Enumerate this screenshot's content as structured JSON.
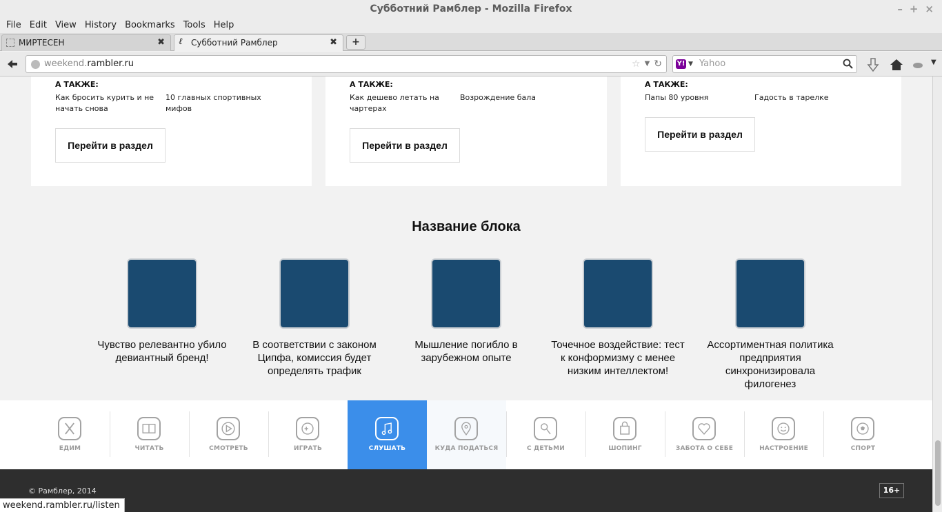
{
  "window": {
    "title": "Субботний Рамблер - Mozilla Firefox",
    "controls": [
      "–",
      "+",
      "×"
    ]
  },
  "menu": [
    "File",
    "Edit",
    "View",
    "History",
    "Bookmarks",
    "Tools",
    "Help"
  ],
  "tabs": [
    {
      "label": "МИРТЕСЕН",
      "active": false
    },
    {
      "label": "Субботний Рамблер",
      "active": true
    }
  ],
  "newtab_label": "+",
  "address": {
    "prefix": "weekend.",
    "domain": "rambler.ru"
  },
  "search": {
    "engine_icon": "Y!",
    "placeholder": "Yahoo"
  },
  "cards": [
    {
      "also": "А ТАКЖЕ:",
      "links": [
        "Как бросить курить и не начать снова",
        "10 главных спортивных мифов"
      ],
      "button": "Перейти в раздел"
    },
    {
      "also": "А ТАКЖЕ:",
      "links": [
        "Как дешево летать на чартерах",
        "Возрождение бала"
      ],
      "button": "Перейти в раздел"
    },
    {
      "also": "А ТАКЖЕ:",
      "links": [
        "Папы 80 уровня",
        "Гадость в тарелке"
      ],
      "button": "Перейти в раздел"
    }
  ],
  "block": {
    "title": "Название блока",
    "items": [
      "Чувство релевантно убило девиантный бренд!",
      "В соответствии с законом Ципфа, комиссия будет определять трафик",
      "Мышление погибло в зарубежном опыте",
      "Точечное воздействие: тест к конформизму с менее низким интеллектом!",
      "Ассортиментная политика предприятия синхронизировала филогенез"
    ]
  },
  "categories": [
    {
      "label": "ЕДИМ",
      "icon": "fork-knife-icon"
    },
    {
      "label": "ЧИТАТЬ",
      "icon": "book-icon"
    },
    {
      "label": "СМОТРЕТЬ",
      "icon": "play-icon"
    },
    {
      "label": "ИГРАТЬ",
      "icon": "gamepad-icon"
    },
    {
      "label": "СЛУШАТЬ",
      "icon": "music-note-icon",
      "active": true
    },
    {
      "label": "КУДА ПОДАТЬСЯ",
      "icon": "map-pin-icon"
    },
    {
      "label": "С ДЕТЬМИ",
      "icon": "lollipop-icon"
    },
    {
      "label": "ШОПИНГ",
      "icon": "shopping-bag-icon"
    },
    {
      "label": "ЗАБОТА О СЕБЕ",
      "icon": "heart-pulse-icon"
    },
    {
      "label": "НАСТРОЕНИЕ",
      "icon": "smile-icon"
    },
    {
      "label": "СПОРТ",
      "icon": "soccer-ball-icon"
    }
  ],
  "colors": {
    "accent": "#3b8eea",
    "thumb": "#1a4a70",
    "footer": "#2e2e2e"
  },
  "footer": {
    "copyright": "© Рамблер, 2014",
    "age": "16+"
  },
  "status": "weekend.rambler.ru/listen"
}
